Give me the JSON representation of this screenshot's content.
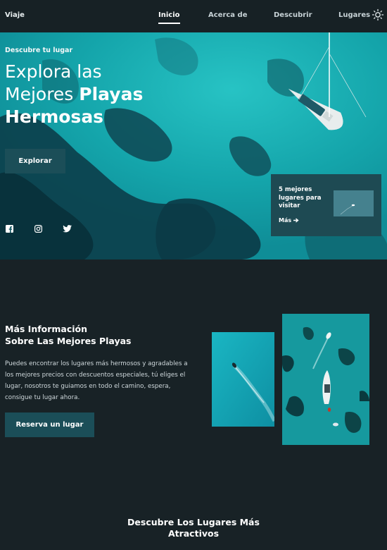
{
  "header": {
    "brand": "Viaje",
    "nav": [
      {
        "label": "Inicio",
        "active": true
      },
      {
        "label": "Acerca de",
        "active": false
      },
      {
        "label": "Descubrir",
        "active": false
      },
      {
        "label": "Lugares",
        "active": false
      }
    ],
    "theme_icon": "sun-icon"
  },
  "hero": {
    "kicker": "Descubre tu lugar",
    "title_line1": "Explora las",
    "title_line2_regular": "Mejores ",
    "title_line2_bold": "Playas",
    "title_line3_bold": "Hermosas",
    "button_label": "Explorar",
    "social_icons": [
      "facebook-icon",
      "instagram-icon",
      "twitter-icon"
    ],
    "card": {
      "title": "5 mejores lugares para visitar",
      "link_label": "Más",
      "link_icon": "arrow-right-icon"
    }
  },
  "info": {
    "title_line1": "Más Información",
    "title_line2": "Sobre Las Mejores Playas",
    "description": "Puedes encontrar los lugares más hermosos y agradables a los mejores precios con descuentos especiales, tú eliges el lugar, nosotros te guiamos en todo el camino, espera, consigue tu lugar ahora.",
    "button_label": "Reserva un lugar"
  },
  "discover": {
    "title_line1": "Descubre Los Lugares Más",
    "title_line2": "Atractivos"
  },
  "colors": {
    "background": "#182226",
    "accent_button": "#1b4e58",
    "card": "#1e4a53",
    "sea": "#14a8ad"
  }
}
